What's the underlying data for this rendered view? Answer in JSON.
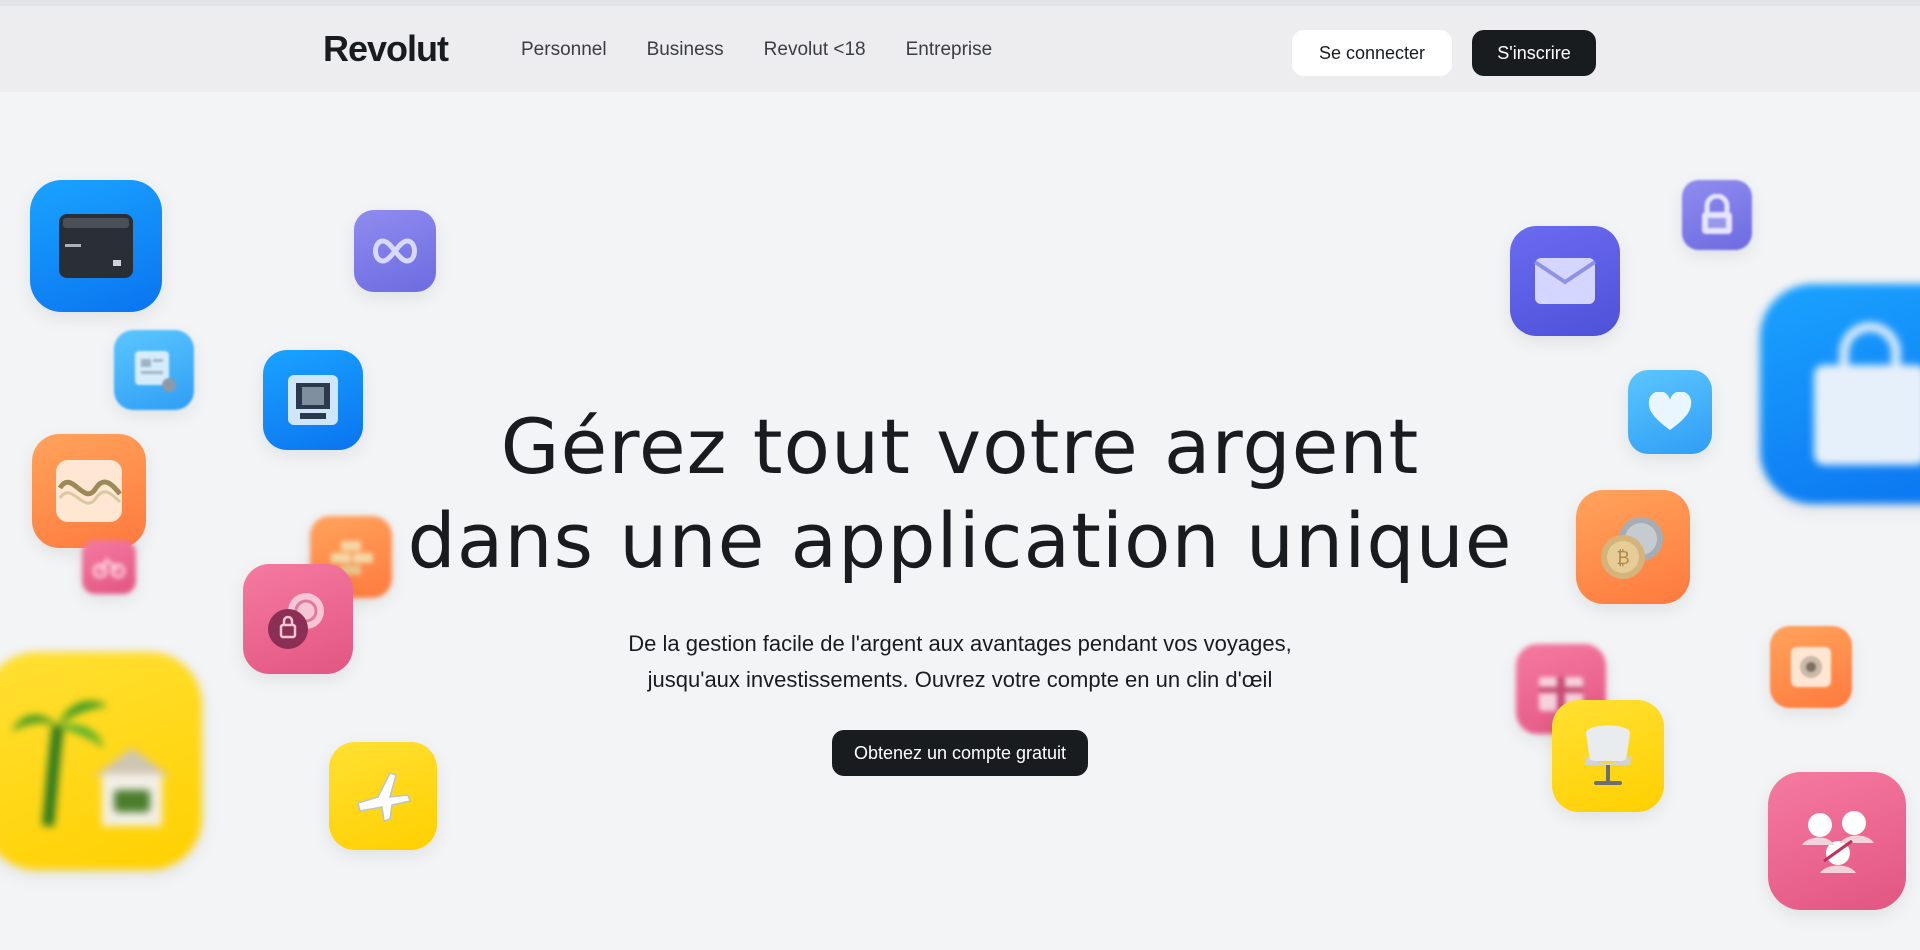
{
  "header": {
    "logo": "Revolut",
    "nav": [
      "Personnel",
      "Business",
      "Revolut <18",
      "Entreprise"
    ],
    "login_label": "Se connecter",
    "signup_label": "S'inscrire"
  },
  "hero": {
    "title_line1": "Gérez tout votre argent",
    "title_line2": "dans une application unique",
    "subtitle_line1": "De la gestion facile de l'argent aux avantages pendant vos voyages,",
    "subtitle_line2": "jusqu'aux investissements. Ouvrez votre compte en un clin d'œil",
    "cta_label": "Obtenez un compte gratuit"
  },
  "icons": [
    "card-icon",
    "infinity-icon",
    "id-card-icon",
    "atm-icon",
    "chart-wave-icon",
    "gold-bars-icon",
    "lock-coin-icon",
    "palm-house-icon",
    "airplane-icon",
    "envelope-icon",
    "padlock-icon",
    "shopping-bag-icon",
    "heart-icon",
    "crypto-coins-icon",
    "gift-icon",
    "chair-icon",
    "vault-icon",
    "people-icon",
    "bicycle-icon"
  ],
  "colors": {
    "brand_dark": "#191c1f",
    "background": "#f3f4f6",
    "header_bg": "#ededef"
  }
}
